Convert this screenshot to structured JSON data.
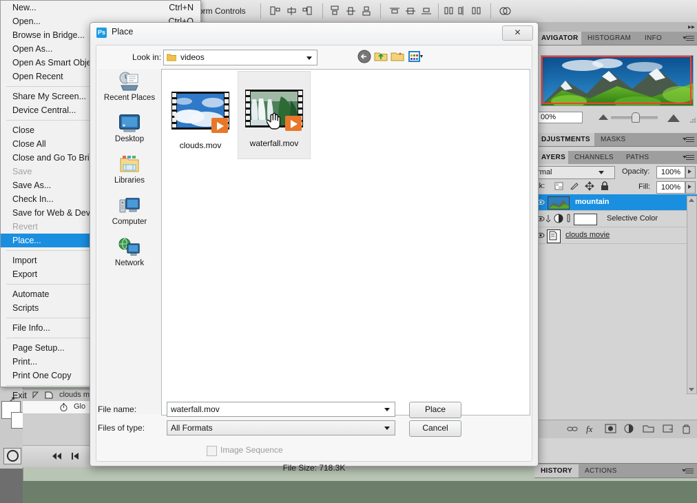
{
  "app": {
    "options_bar": {
      "transform_label": "orm Controls"
    }
  },
  "file_menu": {
    "items": [
      {
        "label": "New...",
        "shortcut": "Ctrl+N",
        "state": "normal"
      },
      {
        "label": "Open...",
        "shortcut": "Ctrl+O",
        "state": "normal"
      },
      {
        "label": "Browse in Bridge...",
        "shortcut": "",
        "state": "normal"
      },
      {
        "label": "Open As...",
        "shortcut": "",
        "state": "normal"
      },
      {
        "label": "Open As Smart Obje",
        "shortcut": "",
        "state": "normal"
      },
      {
        "label": "Open Recent",
        "shortcut": "",
        "state": "normal"
      },
      {
        "label": "---",
        "shortcut": "",
        "state": "sep"
      },
      {
        "label": "Share My Screen...",
        "shortcut": "",
        "state": "normal"
      },
      {
        "label": "Device Central...",
        "shortcut": "",
        "state": "normal"
      },
      {
        "label": "---",
        "shortcut": "",
        "state": "sep"
      },
      {
        "label": "Close",
        "shortcut": "",
        "state": "normal"
      },
      {
        "label": "Close All",
        "shortcut": "",
        "state": "normal"
      },
      {
        "label": "Close and Go To Bric",
        "shortcut": "",
        "state": "normal"
      },
      {
        "label": "Save",
        "shortcut": "",
        "state": "disabled"
      },
      {
        "label": "Save As...",
        "shortcut": "",
        "state": "normal"
      },
      {
        "label": "Check In...",
        "shortcut": "",
        "state": "normal"
      },
      {
        "label": "Save for Web & Devi",
        "shortcut": "",
        "state": "normal"
      },
      {
        "label": "Revert",
        "shortcut": "",
        "state": "disabled"
      },
      {
        "label": "Place...",
        "shortcut": "",
        "state": "selected"
      },
      {
        "label": "---",
        "shortcut": "",
        "state": "sep"
      },
      {
        "label": "Import",
        "shortcut": "",
        "state": "normal"
      },
      {
        "label": "Export",
        "shortcut": "",
        "state": "normal"
      },
      {
        "label": "---",
        "shortcut": "",
        "state": "sep"
      },
      {
        "label": "Automate",
        "shortcut": "",
        "state": "normal"
      },
      {
        "label": "Scripts",
        "shortcut": "",
        "state": "normal"
      },
      {
        "label": "---",
        "shortcut": "",
        "state": "sep"
      },
      {
        "label": "File Info...",
        "shortcut": "",
        "state": "normal"
      },
      {
        "label": "---",
        "shortcut": "",
        "state": "sep"
      },
      {
        "label": "Page Setup...",
        "shortcut": "",
        "state": "normal"
      },
      {
        "label": "Print...",
        "shortcut": "",
        "state": "normal"
      },
      {
        "label": "Print One Copy",
        "shortcut": "",
        "state": "normal"
      },
      {
        "label": "---",
        "shortcut": "",
        "state": "sep"
      },
      {
        "label": "Exit",
        "shortcut": "",
        "state": "normal"
      }
    ]
  },
  "place_dialog": {
    "title": "Place",
    "app_icon": "Ps",
    "close_glyph": "✕",
    "lookin_label": "Look in:",
    "lookin_value": "videos",
    "toolbar_buttons": [
      {
        "name": "back-button",
        "tip": "Back"
      },
      {
        "name": "up-folder-button",
        "tip": "Up One Level"
      },
      {
        "name": "new-folder-button",
        "tip": "Create New Folder"
      },
      {
        "name": "views-button",
        "tip": "Views"
      }
    ],
    "places": [
      {
        "label": "Recent Places",
        "icon": "recent-places-icon"
      },
      {
        "label": "Desktop",
        "icon": "desktop-icon"
      },
      {
        "label": "Libraries",
        "icon": "libraries-icon"
      },
      {
        "label": "Computer",
        "icon": "computer-icon"
      },
      {
        "label": "Network",
        "icon": "network-icon"
      }
    ],
    "files": [
      {
        "name": "clouds.mov",
        "selected": false,
        "kind": "movie"
      },
      {
        "name": "waterfall.mov",
        "selected": true,
        "kind": "movie"
      }
    ],
    "filename_label": "File name:",
    "filename_value": "waterfall.mov",
    "filetype_label": "Files of type:",
    "filetype_value": "All Formats",
    "place_button": "Place",
    "cancel_button": "Cancel",
    "image_sequence_label": "Image Sequence",
    "image_sequence_checked": false,
    "image_sequence_enabled": false,
    "file_size_text": "File Size: 718.3K"
  },
  "navigator_panel": {
    "tabs": [
      {
        "label": "AVIGATOR",
        "active": true
      },
      {
        "label": "HISTOGRAM",
        "active": false
      },
      {
        "label": "INFO",
        "active": false
      }
    ],
    "zoom_value": "00%"
  },
  "adjustments_panel": {
    "tabs": [
      {
        "label": "DJUSTMENTS",
        "active": true
      },
      {
        "label": "MASKS",
        "active": false
      }
    ]
  },
  "layers_panel": {
    "tabs": [
      {
        "label": "AYERS",
        "active": true
      },
      {
        "label": "CHANNELS",
        "active": false
      },
      {
        "label": "PATHS",
        "active": false
      }
    ],
    "blend_mode": "ormal",
    "opacity_label": "Opacity:",
    "opacity_value": "100%",
    "lock_label": "ock:",
    "fill_label": "Fill:",
    "fill_value": "100%",
    "layers": [
      {
        "name": "mountain",
        "selected": true,
        "type": "image",
        "underline": false
      },
      {
        "name": "Selective Color",
        "selected": false,
        "type": "adjustment",
        "underline": false
      },
      {
        "name": "clouds movie",
        "selected": false,
        "type": "video",
        "underline": true
      }
    ],
    "footer_icons": [
      "link-layers-icon",
      "layer-style-fx-icon",
      "layer-mask-icon",
      "new-adjustment-layer-icon",
      "new-group-icon",
      "new-layer-icon",
      "delete-layer-icon"
    ]
  },
  "bottom_panel": {
    "tabs": [
      {
        "label": "HISTORY",
        "active": true
      },
      {
        "label": "ACTIONS",
        "active": false
      }
    ]
  },
  "timeline_panel": {
    "layer_name": "clouds m",
    "property_name": "Glo",
    "controls": [
      "go-to-first-frame-icon",
      "previous-frame-icon",
      "play-icon",
      "next-frame-icon",
      "audio-mute-icon",
      "onion-skin-icon",
      "delete-keyframe-icon"
    ]
  },
  "colors": {
    "accent": "#1a8fe0",
    "panel_bg": "#d4d4d4",
    "dialog_bg": "#f0f0f0",
    "nav_box": "#ff3b30"
  }
}
